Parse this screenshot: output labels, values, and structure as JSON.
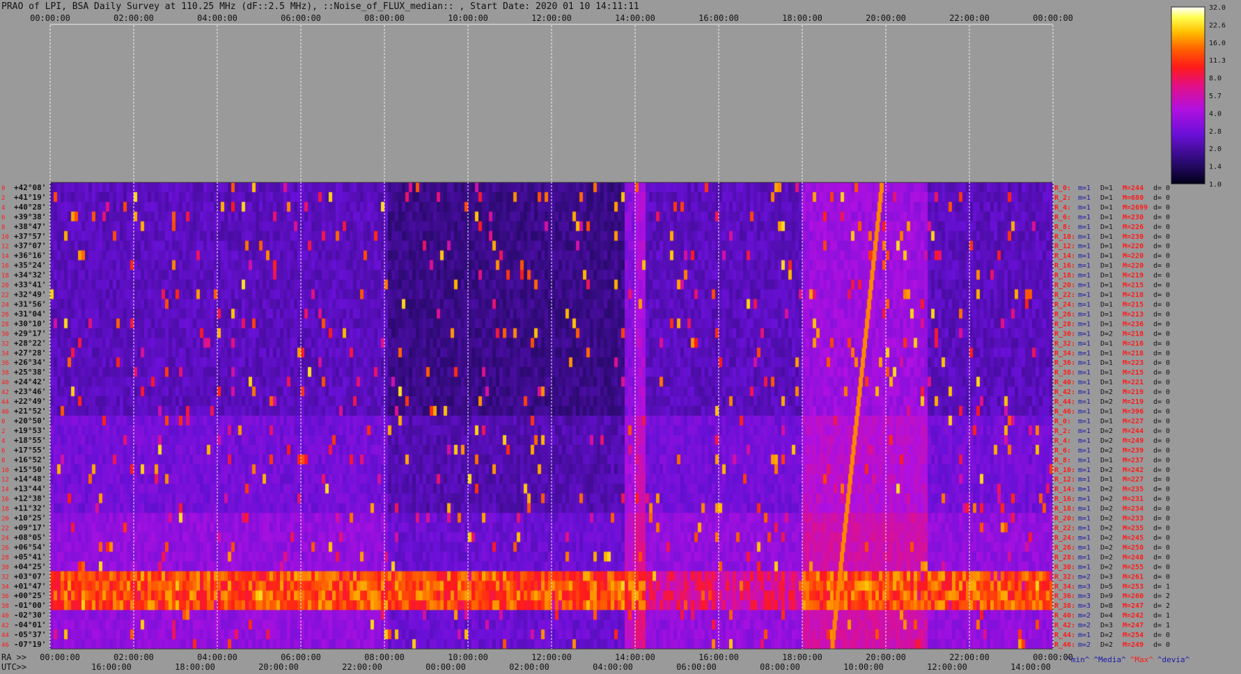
{
  "title": "PRAO of LPI, BSA Daily Survey at 110.25 MHz (dF::2.5 MHz), ::Noise_of_FLUX_median:: , Start Date: 2020 01 10 14:11:11",
  "colors": {
    "background": "#9a9a9a",
    "row_label_red": "#ff1a1a",
    "dec_label": "#111111",
    "row_info_blue": "#1a1aa8",
    "grid": "#e8e8e8"
  },
  "bottom_labels": {
    "ra": "RA >>",
    "utc": "UTC>>"
  },
  "footer": {
    "min": "^min^",
    "media": "^Media^",
    "max": "^Max^",
    "devia": "^devia^"
  },
  "chart_data": {
    "type": "heatmap",
    "title": "PRAO of LPI, BSA Daily Survey at 110.25 MHz (dF::2.5 MHz), ::Noise_of_FLUX_median:: , Start Date: 2020 01 10 14:11:11",
    "top_ticks": [
      "00:00:00",
      "02:00:00",
      "04:00:00",
      "06:00:00",
      "08:00:00",
      "10:00:00",
      "12:00:00",
      "14:00:00",
      "16:00:00",
      "18:00:00",
      "20:00:00",
      "22:00:00",
      "00:00:00"
    ],
    "ra_ticks": [
      "00:00:00",
      "02:00:00",
      "04:00:00",
      "06:00:00",
      "08:00:00",
      "10:00:00",
      "12:00:00",
      "14:00:00",
      "16:00:00",
      "18:00:00",
      "20:00:00",
      "22:00:00",
      "00:00:00"
    ],
    "utc_ticks": [
      "16:00:00",
      "18:00:00",
      "20:00:00",
      "22:00:00",
      "00:00:00",
      "02:00:00",
      "04:00:00",
      "06:00:00",
      "08:00:00",
      "10:00:00",
      "12:00:00",
      "14:00:00"
    ],
    "colorbar": {
      "ticks": [
        "32.0",
        "22.6",
        "16.0",
        "11.3",
        "8.0",
        "5.7",
        "4.0",
        "2.8",
        "2.0",
        "1.4",
        "1.0"
      ],
      "scale": "log",
      "range": [
        1.0,
        32.0
      ]
    },
    "rows": [
      {
        "idx": "0",
        "dec": "+42°08'",
        "r": "R_0:",
        "m": "m=1",
        "d": "D=1",
        "M": "M=244",
        "dd": "d= 0"
      },
      {
        "idx": "2",
        "dec": "+41°19'",
        "r": "R_2:",
        "m": "m=1",
        "d": "D=1",
        "M": "M=680",
        "dd": "d= 0"
      },
      {
        "idx": "4",
        "dec": "+40°28'",
        "r": "R_4:",
        "m": "m=1",
        "d": "D=1",
        "M": "M=2699",
        "dd": "d= 0"
      },
      {
        "idx": "6",
        "dec": "+39°38'",
        "r": "R_6:",
        "m": "m=1",
        "d": "D=1",
        "M": "M=230",
        "dd": "d= 0"
      },
      {
        "idx": "8",
        "dec": "+38°47'",
        "r": "R_8:",
        "m": "m=1",
        "d": "D=1",
        "M": "M=226",
        "dd": "d= 0"
      },
      {
        "idx": "10",
        "dec": "+37°57'",
        "r": "R_10:",
        "m": "m=1",
        "d": "D=1",
        "M": "M=230",
        "dd": "d= 0"
      },
      {
        "idx": "12",
        "dec": "+37°07'",
        "r": "R_12:",
        "m": "m=1",
        "d": "D=1",
        "M": "M=220",
        "dd": "d= 0"
      },
      {
        "idx": "14",
        "dec": "+36°16'",
        "r": "R_14:",
        "m": "m=1",
        "d": "D=1",
        "M": "M=220",
        "dd": "d= 0"
      },
      {
        "idx": "16",
        "dec": "+35°24'",
        "r": "R_16:",
        "m": "m=1",
        "d": "D=1",
        "M": "M=220",
        "dd": "d= 0"
      },
      {
        "idx": "18",
        "dec": "+34°32'",
        "r": "R_18:",
        "m": "m=1",
        "d": "D=1",
        "M": "M=219",
        "dd": "d= 0"
      },
      {
        "idx": "20",
        "dec": "+33°41'",
        "r": "R_20:",
        "m": "m=1",
        "d": "D=1",
        "M": "M=215",
        "dd": "d= 0"
      },
      {
        "idx": "22",
        "dec": "+32°49'",
        "r": "R_22:",
        "m": "m=1",
        "d": "D=1",
        "M": "M=218",
        "dd": "d= 0"
      },
      {
        "idx": "24",
        "dec": "+31°56'",
        "r": "R_24:",
        "m": "m=1",
        "d": "D=1",
        "M": "M=215",
        "dd": "d= 0"
      },
      {
        "idx": "26",
        "dec": "+31°04'",
        "r": "R_26:",
        "m": "m=1",
        "d": "D=1",
        "M": "M=213",
        "dd": "d= 0"
      },
      {
        "idx": "28",
        "dec": "+30°10'",
        "r": "R_28:",
        "m": "m=1",
        "d": "D=1",
        "M": "M=236",
        "dd": "d= 0"
      },
      {
        "idx": "30",
        "dec": "+29°17'",
        "r": "R_30:",
        "m": "m=1",
        "d": "D=2",
        "M": "M=218",
        "dd": "d= 0"
      },
      {
        "idx": "32",
        "dec": "+28°22'",
        "r": "R_32:",
        "m": "m=1",
        "d": "D=1",
        "M": "M=216",
        "dd": "d= 0"
      },
      {
        "idx": "34",
        "dec": "+27°28'",
        "r": "R_34:",
        "m": "m=1",
        "d": "D=1",
        "M": "M=218",
        "dd": "d= 0"
      },
      {
        "idx": "36",
        "dec": "+26°34'",
        "r": "R_36:",
        "m": "m=1",
        "d": "D=1",
        "M": "M=223",
        "dd": "d= 0"
      },
      {
        "idx": "38",
        "dec": "+25°38'",
        "r": "R_38:",
        "m": "m=1",
        "d": "D=1",
        "M": "M=215",
        "dd": "d= 0"
      },
      {
        "idx": "40",
        "dec": "+24°42'",
        "r": "R_40:",
        "m": "m=1",
        "d": "D=1",
        "M": "M=221",
        "dd": "d= 0"
      },
      {
        "idx": "42",
        "dec": "+23°46'",
        "r": "R_42:",
        "m": "m=1",
        "d": "D=2",
        "M": "M=219",
        "dd": "d= 0"
      },
      {
        "idx": "44",
        "dec": "+22°49'",
        "r": "R_44:",
        "m": "m=1",
        "d": "D=2",
        "M": "M=219",
        "dd": "d= 0"
      },
      {
        "idx": "46",
        "dec": "+21°52'",
        "r": "R_46:",
        "m": "m=1",
        "d": "D=1",
        "M": "M=396",
        "dd": "d= 0"
      },
      {
        "idx": "0",
        "dec": "+20°50'",
        "r": "R_0:",
        "m": "m=1",
        "d": "D=1",
        "M": "M=227",
        "dd": "d= 0"
      },
      {
        "idx": "2",
        "dec": "+19°53'",
        "r": "R_2:",
        "m": "m=1",
        "d": "D=2",
        "M": "M=244",
        "dd": "d= 0"
      },
      {
        "idx": "4",
        "dec": "+18°55'",
        "r": "R_4:",
        "m": "m=1",
        "d": "D=2",
        "M": "M=249",
        "dd": "d= 0"
      },
      {
        "idx": "6",
        "dec": "+17°55'",
        "r": "R_6:",
        "m": "m=1",
        "d": "D=2",
        "M": "M=239",
        "dd": "d= 0"
      },
      {
        "idx": "8",
        "dec": "+16°52'",
        "r": "R_8:",
        "m": "m=1",
        "d": "D=1",
        "M": "M=237",
        "dd": "d= 0"
      },
      {
        "idx": "10",
        "dec": "+15°50'",
        "r": "R_10:",
        "m": "m=1",
        "d": "D=2",
        "M": "M=242",
        "dd": "d= 0"
      },
      {
        "idx": "12",
        "dec": "+14°48'",
        "r": "R_12:",
        "m": "m=1",
        "d": "D=1",
        "M": "M=227",
        "dd": "d= 0"
      },
      {
        "idx": "14",
        "dec": "+13°44'",
        "r": "R_14:",
        "m": "m=1",
        "d": "D=2",
        "M": "M=235",
        "dd": "d= 0"
      },
      {
        "idx": "16",
        "dec": "+12°38'",
        "r": "R_16:",
        "m": "m=1",
        "d": "D=2",
        "M": "M=231",
        "dd": "d= 0"
      },
      {
        "idx": "18",
        "dec": "+11°32'",
        "r": "R_18:",
        "m": "m=1",
        "d": "D=2",
        "M": "M=234",
        "dd": "d= 0"
      },
      {
        "idx": "20",
        "dec": "+10°25'",
        "r": "R_20:",
        "m": "m=1",
        "d": "D=2",
        "M": "M=233",
        "dd": "d= 0"
      },
      {
        "idx": "22",
        "dec": "+09°17'",
        "r": "R_22:",
        "m": "m=1",
        "d": "D=2",
        "M": "M=235",
        "dd": "d= 0"
      },
      {
        "idx": "24",
        "dec": "+08°05'",
        "r": "R_24:",
        "m": "m=1",
        "d": "D=2",
        "M": "M=245",
        "dd": "d= 0"
      },
      {
        "idx": "26",
        "dec": "+06°54'",
        "r": "R_26:",
        "m": "m=1",
        "d": "D=2",
        "M": "M=250",
        "dd": "d= 0"
      },
      {
        "idx": "28",
        "dec": "+05°41'",
        "r": "R_28:",
        "m": "m=1",
        "d": "D=2",
        "M": "M=248",
        "dd": "d= 0"
      },
      {
        "idx": "30",
        "dec": "+04°25'",
        "r": "R_30:",
        "m": "m=1",
        "d": "D=2",
        "M": "M=255",
        "dd": "d= 0"
      },
      {
        "idx": "32",
        "dec": "+03°07'",
        "r": "R_32:",
        "m": "m=2",
        "d": "D=3",
        "M": "M=261",
        "dd": "d= 0"
      },
      {
        "idx": "34",
        "dec": "+01°47'",
        "r": "R_34:",
        "m": "m=3",
        "d": "D=5",
        "M": "M=253",
        "dd": "d= 1"
      },
      {
        "idx": "36",
        "dec": "+00°25'",
        "r": "R_36:",
        "m": "m=3",
        "d": "D=9",
        "M": "M=260",
        "dd": "d= 2"
      },
      {
        "idx": "38",
        "dec": "-01°00'",
        "r": "R_38:",
        "m": "m=3",
        "d": "D=8",
        "M": "M=247",
        "dd": "d= 2"
      },
      {
        "idx": "40",
        "dec": "-02°30'",
        "r": "R_40:",
        "m": "m=2",
        "d": "D=4",
        "M": "M=242",
        "dd": "d= 1"
      },
      {
        "idx": "42",
        "dec": "-04°01'",
        "r": "R_42:",
        "m": "m=2",
        "d": "D=3",
        "M": "M=247",
        "dd": "d= 1"
      },
      {
        "idx": "44",
        "dec": "-05°37'",
        "r": "R_44:",
        "m": "m=1",
        "d": "D=2",
        "M": "M=254",
        "dd": "d= 0"
      },
      {
        "idx": "46",
        "dec": "-07°19'",
        "r": "R_46:",
        "m": "m=2",
        "d": "D=2",
        "M": "M=249",
        "dd": "d= 0"
      }
    ]
  }
}
